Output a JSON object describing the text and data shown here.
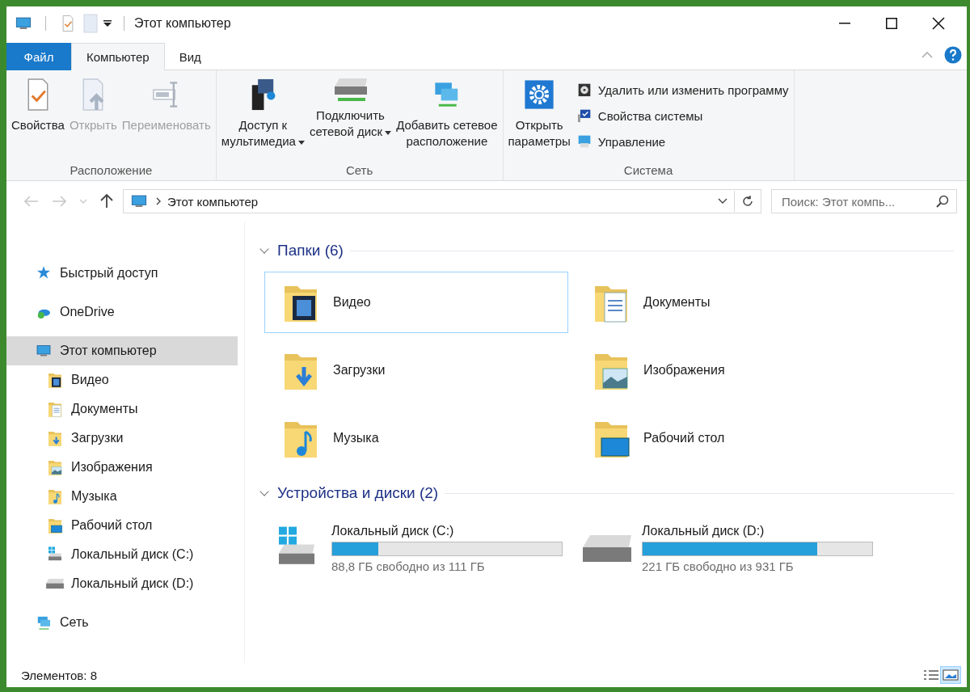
{
  "window": {
    "title": "Этот компьютер"
  },
  "tabs": [
    {
      "label": "Файл",
      "kind": "file",
      "selected": false
    },
    {
      "label": "Компьютер",
      "kind": "tab",
      "selected": true
    },
    {
      "label": "Вид",
      "kind": "tab",
      "selected": false
    }
  ],
  "ribbon": {
    "groups": [
      {
        "label": "Расположение",
        "buttons": [
          {
            "label": "Свойства",
            "kind": "properties",
            "disabled": false,
            "dropdown": false
          },
          {
            "label": "Открыть",
            "kind": "open",
            "disabled": true,
            "dropdown": false
          },
          {
            "label": "Переименовать",
            "kind": "rename",
            "disabled": true,
            "dropdown": false
          }
        ]
      },
      {
        "label": "Сеть",
        "buttons": [
          {
            "label": "Доступ к\nмультимедиа",
            "kind": "media",
            "disabled": false,
            "dropdown": true
          },
          {
            "label": "Подключить\nсетевой диск",
            "kind": "netdrive",
            "disabled": false,
            "dropdown": true
          },
          {
            "label": "Добавить сетевое\nрасположение",
            "kind": "netloc",
            "disabled": false,
            "dropdown": false
          }
        ]
      },
      {
        "label": "Система",
        "buttons": [
          {
            "label": "Открыть\nпараметры",
            "kind": "settings",
            "disabled": false,
            "dropdown": false
          }
        ],
        "small": [
          {
            "label": "Удалить или изменить программу",
            "kind": "uninstall"
          },
          {
            "label": "Свойства системы",
            "kind": "sysprops"
          },
          {
            "label": "Управление",
            "kind": "manage"
          }
        ]
      }
    ]
  },
  "address": {
    "path": "Этот компьютер",
    "search_placeholder": "Поиск: Этот компь..."
  },
  "sidebar": {
    "items": [
      {
        "label": "Быстрый доступ",
        "kind": "star",
        "selected": false
      },
      {
        "label": "OneDrive",
        "kind": "cloud",
        "selected": false
      },
      {
        "label": "Этот компьютер",
        "kind": "pc",
        "selected": true,
        "children": [
          {
            "label": "Видео",
            "kind": "video",
            "selected": false
          },
          {
            "label": "Документы",
            "kind": "docs",
            "selected": false
          },
          {
            "label": "Загрузки",
            "kind": "downloads",
            "selected": false
          },
          {
            "label": "Изображения",
            "kind": "pictures",
            "selected": false
          },
          {
            "label": "Музыка",
            "kind": "music",
            "selected": false
          },
          {
            "label": "Рабочий стол",
            "kind": "desktop",
            "selected": false
          },
          {
            "label": "Локальный диск (C:)",
            "kind": "sysdrive",
            "selected": false
          },
          {
            "label": "Локальный диск (D:)",
            "kind": "drive",
            "selected": false
          }
        ]
      },
      {
        "label": "Сеть",
        "kind": "network",
        "selected": false
      }
    ]
  },
  "sections": [
    {
      "title": "Папки (6)",
      "expanded": true,
      "kind": "folders",
      "items": [
        {
          "name": "Видео",
          "kind": "video",
          "selected": true
        },
        {
          "name": "Документы",
          "kind": "docs",
          "selected": false
        },
        {
          "name": "Загрузки",
          "kind": "downloads",
          "selected": false
        },
        {
          "name": "Изображения",
          "kind": "pictures",
          "selected": false
        },
        {
          "name": "Музыка",
          "kind": "music",
          "selected": false
        },
        {
          "name": "Рабочий стол",
          "kind": "desktop",
          "selected": false
        }
      ]
    },
    {
      "title": "Устройства и диски (2)",
      "expanded": true,
      "kind": "drives",
      "items": [
        {
          "name": "Локальный диск (C:)",
          "kind": "sysdrive",
          "level": 0.2,
          "free": "88,8 ГБ свободно из 111 ГБ",
          "selected": false
        },
        {
          "name": "Локальный диск (D:)",
          "kind": "drive",
          "level": 0.76,
          "free": "221 ГБ свободно из 931 ГБ",
          "selected": false
        }
      ]
    }
  ],
  "status_bar": {
    "text": "Элементов: 8",
    "views": [
      {
        "kind": "details",
        "selected": false
      },
      {
        "kind": "tiles",
        "selected": true
      }
    ]
  }
}
